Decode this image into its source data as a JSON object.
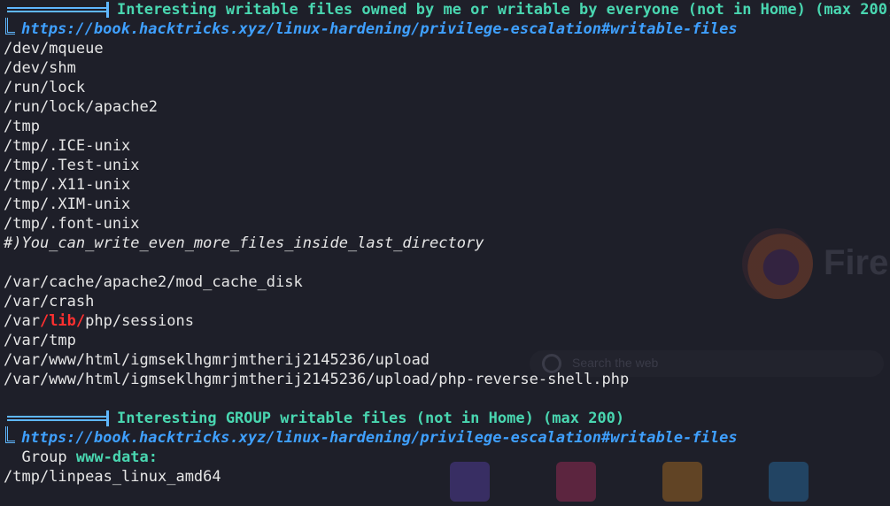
{
  "background": {
    "brand_text": "Fire",
    "search_placeholder": "Search the web"
  },
  "section1": {
    "title": "Interesting writable files owned by me or writable by everyone (not in Home) (max 200)",
    "link": "https://book.hacktricks.xyz/linux-hardening/privilege-escalation#writable-files",
    "lines": [
      "/dev/mqueue",
      "/dev/shm",
      "/run/lock",
      "/run/lock/apache2",
      "/tmp",
      "/tmp/.ICE-unix",
      "/tmp/.Test-unix",
      "/tmp/.X11-unix",
      "/tmp/.XIM-unix",
      "/tmp/.font-unix"
    ],
    "note": "#)You_can_write_even_more_files_inside_last_directory",
    "lines2": [
      "/var/cache/apache2/mod_cache_disk",
      "/var/crash"
    ],
    "highlight_line": {
      "prefix": "/var",
      "highlight": "/lib/",
      "suffix": "php/sessions"
    },
    "lines3": [
      "/var/tmp",
      "/var/www/html/igmseklhgmrjmtherij2145236/upload",
      "/var/www/html/igmseklhgmrjmtherij2145236/upload/php-reverse-shell.php"
    ]
  },
  "section2": {
    "title": "Interesting GROUP writable files (not in Home) (max 200)",
    "link": "https://book.hacktricks.xyz/linux-hardening/privilege-escalation#writable-files",
    "group_label": "  Group ",
    "group_name": "www-data:",
    "lines": [
      "/tmp/linpeas_linux_amd64"
    ]
  },
  "colors": {
    "background": "#1e1f29",
    "banner_title": "#49d6b0",
    "link": "#3fa0ff",
    "highlight": "#ff3030",
    "text": "#e6e6e6"
  }
}
